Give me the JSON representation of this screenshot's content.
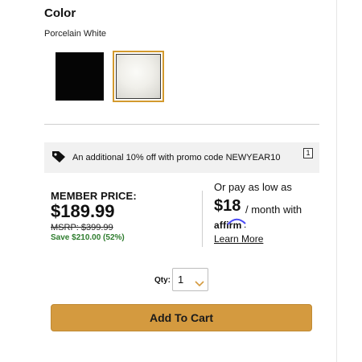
{
  "color": {
    "heading": "Color",
    "selected_value": "Porcelain White",
    "swatches": [
      {
        "name": "Black",
        "hex": "#0a0a0a",
        "selected": false
      },
      {
        "name": "Porcelain White",
        "hex": "#f0efea",
        "selected": true
      }
    ],
    "selected_border_color": "#d39a2e"
  },
  "promo": {
    "icon": "tag-icon",
    "text": "An additional 10% off with promo code NEWYEAR10",
    "info_badge": "1"
  },
  "pricing": {
    "member_label": "MEMBER PRICE:",
    "member_price": "$189.99",
    "msrp": "MSRP: $399.99",
    "savings": "Save $210.00 (52%)",
    "savings_color": "#2e7d2e"
  },
  "financing": {
    "intro": "Or pay as low as",
    "amount": "$18",
    "suffix": "/ month with",
    "brand": "affirm",
    "brand_punct": ".",
    "learn_more": "Learn More"
  },
  "quantity": {
    "label": "Qty:",
    "value": "1",
    "icon": "chevron-down-icon"
  },
  "cart": {
    "button_label": "Add To Cart",
    "button_color": "#d49a3f"
  }
}
